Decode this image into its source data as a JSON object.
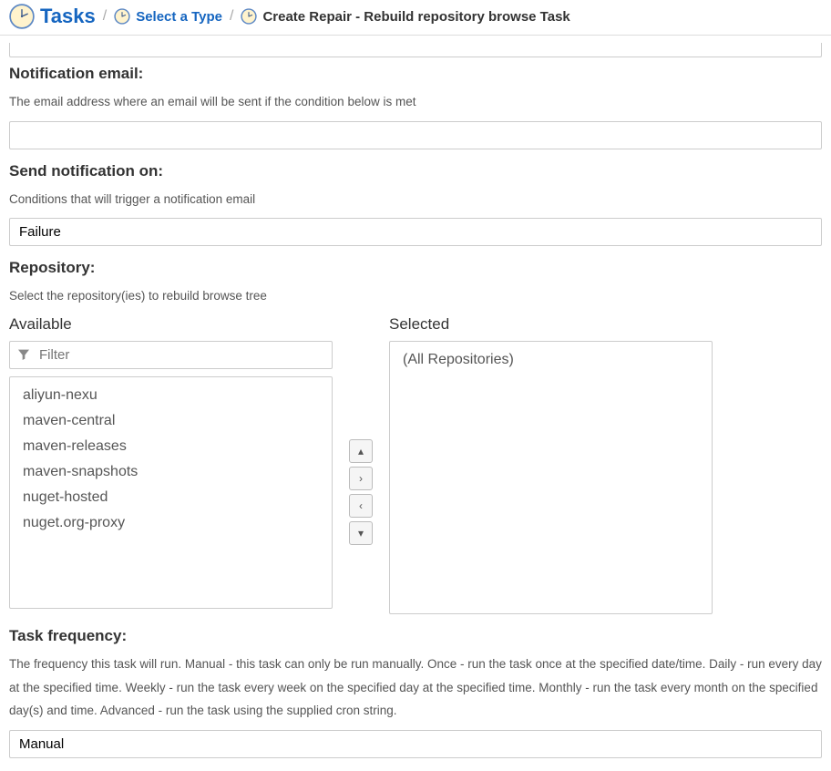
{
  "breadcrumb": {
    "tasks": "Tasks",
    "select_type": "Select a Type",
    "create_repair": "Create Repair - Rebuild repository browse Task"
  },
  "notification_email": {
    "label": "Notification email:",
    "help": "The email address where an email will be sent if the condition below is met",
    "value": ""
  },
  "send_notification": {
    "label": "Send notification on:",
    "help": "Conditions that will trigger a notification email",
    "value": "Failure"
  },
  "repository": {
    "label": "Repository:",
    "help": "Select the repository(ies) to rebuild browse tree",
    "available_title": "Available",
    "selected_title": "Selected",
    "filter_placeholder": "Filter",
    "available": [
      "aliyun-nexu",
      "maven-central",
      "maven-releases",
      "maven-snapshots",
      "nuget-hosted",
      "nuget.org-proxy"
    ],
    "selected": [
      "(All Repositories)"
    ]
  },
  "task_frequency": {
    "label": "Task frequency:",
    "help": "The frequency this task will run. Manual - this task can only be run manually. Once - run the task once at the specified date/time. Daily - run every day at the specified time. Weekly - run the task every week on the specified day at the specified time. Monthly - run the task every month on the specified day(s) and time. Advanced - run the task using the supplied cron string.",
    "value": "Manual"
  }
}
